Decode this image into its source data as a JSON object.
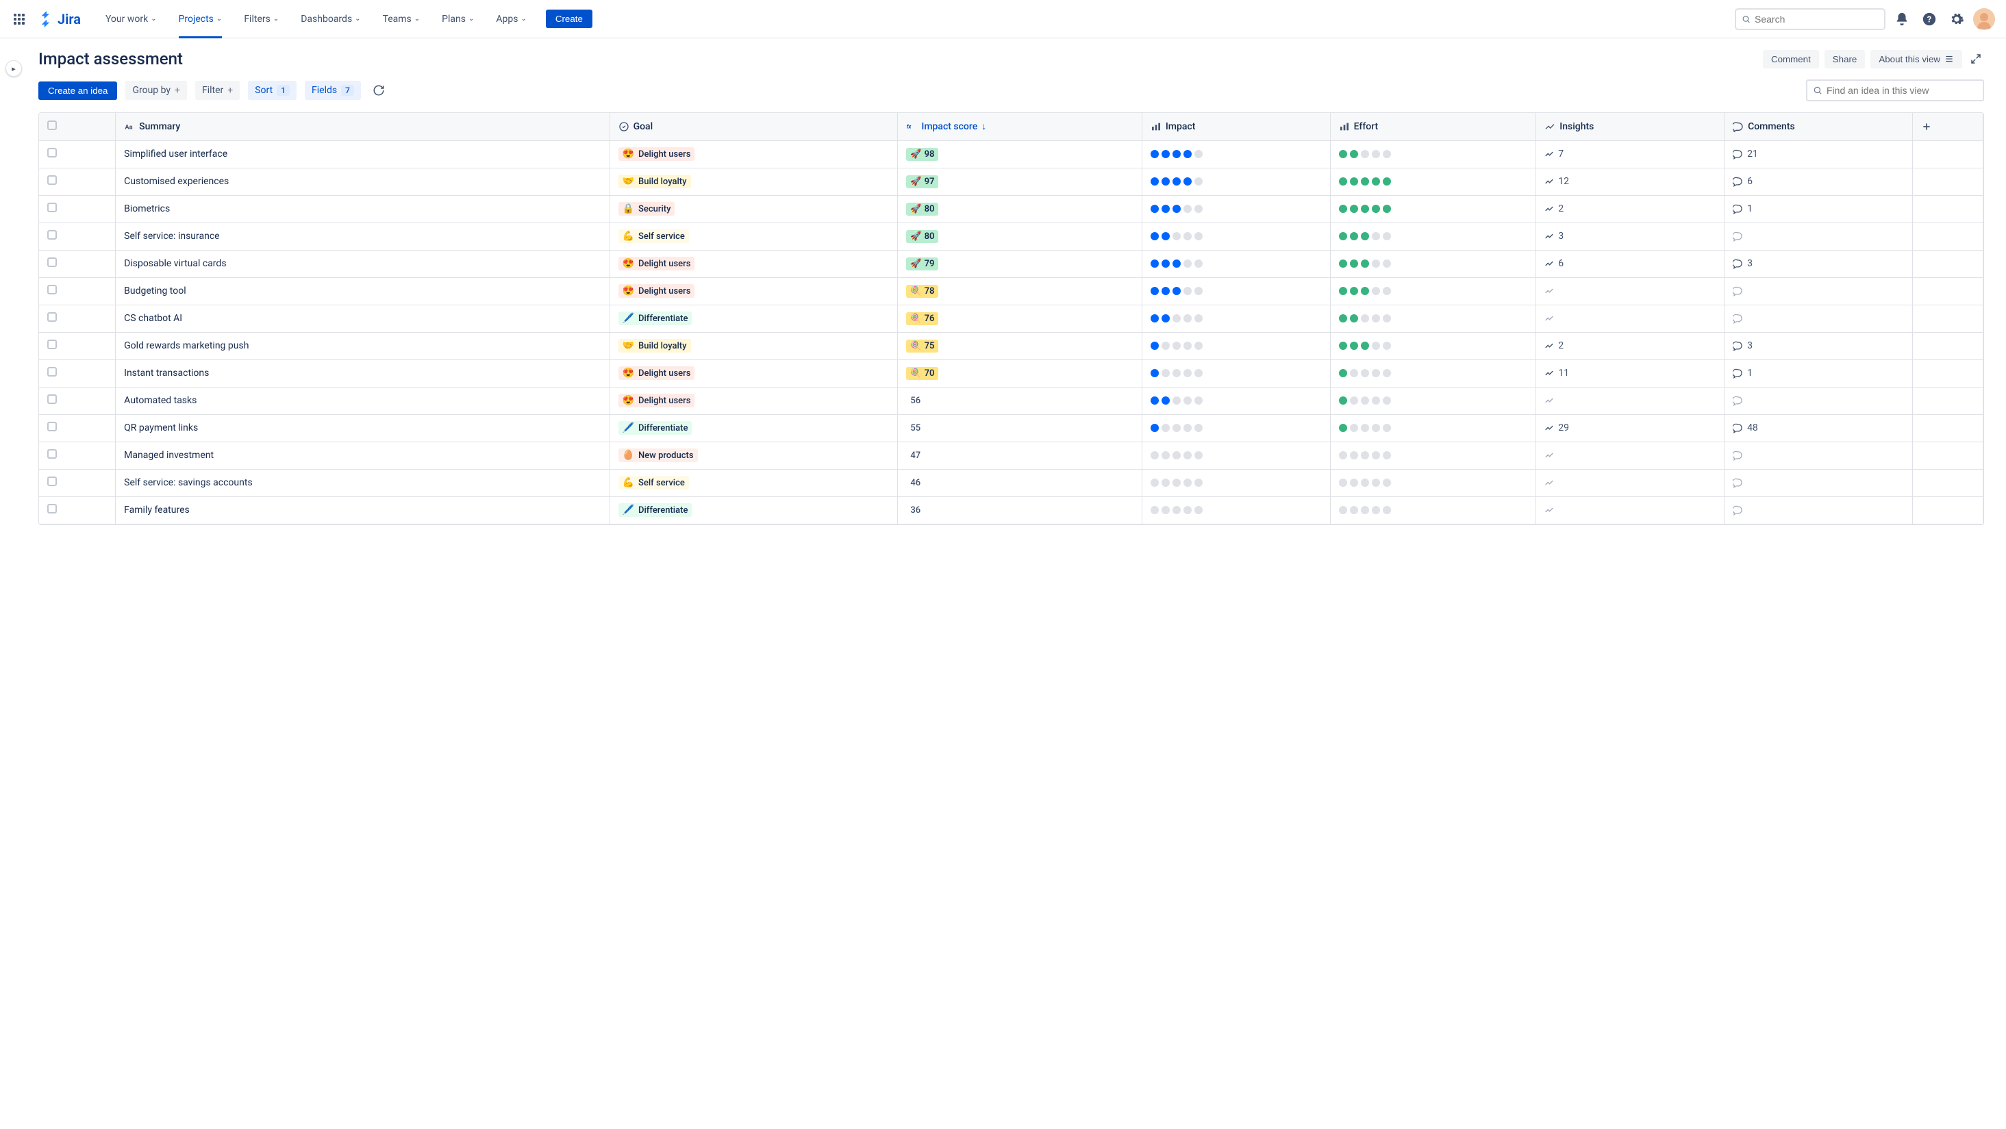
{
  "nav": {
    "logo_text": "Jira",
    "items": [
      "Your work",
      "Projects",
      "Filters",
      "Dashboards",
      "Teams",
      "Plans",
      "Apps"
    ],
    "active_index": 1,
    "create_label": "Create",
    "search_placeholder": "Search"
  },
  "page": {
    "title": "Impact assessment",
    "actions": {
      "comment": "Comment",
      "share": "Share",
      "about": "About this view"
    }
  },
  "toolbar": {
    "create_idea": "Create an idea",
    "group_by": "Group by",
    "filter": "Filter",
    "sort": "Sort",
    "sort_count": "1",
    "fields": "Fields",
    "fields_count": "7",
    "find_placeholder": "Find an idea in this view"
  },
  "columns": {
    "summary": "Summary",
    "goal": "Goal",
    "impact_score": "Impact score",
    "impact": "Impact",
    "effort": "Effort",
    "insights": "Insights",
    "comments": "Comments"
  },
  "goal_styles": {
    "Delight users": {
      "emoji": "😍",
      "bg": "#FFEBE6",
      "fg": "#172B4D"
    },
    "Build loyalty": {
      "emoji": "🤝",
      "bg": "#FFF7D6",
      "fg": "#172B4D"
    },
    "Security": {
      "emoji": "🔒",
      "bg": "#FFEBE6",
      "fg": "#172B4D"
    },
    "Self service": {
      "emoji": "💪",
      "bg": "#FFFAE6",
      "fg": "#172B4D"
    },
    "Differentiate": {
      "emoji": "🖊️",
      "bg": "#E3FCEF",
      "fg": "#172B4D"
    },
    "New products": {
      "emoji": "🥚",
      "bg": "#FDEEEA",
      "fg": "#172B4D"
    }
  },
  "rows": [
    {
      "summary": "Simplified user interface",
      "goal": "Delight users",
      "score": 98,
      "score_band": "green",
      "impact": 4,
      "effort": 2,
      "insights": 7,
      "comments": 21
    },
    {
      "summary": "Customised experiences",
      "goal": "Build loyalty",
      "score": 97,
      "score_band": "green",
      "impact": 4,
      "effort": 5,
      "insights": 12,
      "comments": 6
    },
    {
      "summary": "Biometrics",
      "goal": "Security",
      "score": 80,
      "score_band": "green",
      "impact": 3,
      "effort": 5,
      "insights": 2,
      "comments": 1
    },
    {
      "summary": "Self service: insurance",
      "goal": "Self service",
      "score": 80,
      "score_band": "green",
      "impact": 2,
      "effort": 3,
      "insights": 3,
      "comments": null
    },
    {
      "summary": "Disposable virtual cards",
      "goal": "Delight users",
      "score": 79,
      "score_band": "green",
      "impact": 3,
      "effort": 3,
      "insights": 6,
      "comments": 3
    },
    {
      "summary": "Budgeting tool",
      "goal": "Delight users",
      "score": 78,
      "score_band": "yellow",
      "impact": 3,
      "effort": 3,
      "insights": null,
      "comments": null
    },
    {
      "summary": "CS chatbot AI",
      "goal": "Differentiate",
      "score": 76,
      "score_band": "yellow",
      "impact": 2,
      "effort": 2,
      "insights": null,
      "comments": null
    },
    {
      "summary": "Gold rewards marketing push",
      "goal": "Build loyalty",
      "score": 75,
      "score_band": "yellow",
      "impact": 1,
      "effort": 3,
      "insights": 2,
      "comments": 3
    },
    {
      "summary": "Instant transactions",
      "goal": "Delight users",
      "score": 70,
      "score_band": "yellow",
      "impact": 1,
      "effort": 1,
      "insights": 11,
      "comments": 1
    },
    {
      "summary": "Automated tasks",
      "goal": "Delight users",
      "score": 56,
      "score_band": "plain",
      "impact": 2,
      "effort": 1,
      "insights": null,
      "comments": null
    },
    {
      "summary": "QR payment links",
      "goal": "Differentiate",
      "score": 55,
      "score_band": "plain",
      "impact": 1,
      "effort": 1,
      "insights": 29,
      "comments": 48
    },
    {
      "summary": "Managed investment",
      "goal": "New products",
      "score": 47,
      "score_band": "plain",
      "impact": 0,
      "effort": 0,
      "insights": null,
      "comments": null
    },
    {
      "summary": "Self service: savings accounts",
      "goal": "Self service",
      "score": 46,
      "score_band": "plain",
      "impact": 0,
      "effort": 0,
      "insights": null,
      "comments": null
    },
    {
      "summary": "Family features",
      "goal": "Differentiate",
      "score": 36,
      "score_band": "plain",
      "impact": 0,
      "effort": 0,
      "insights": null,
      "comments": null
    }
  ]
}
